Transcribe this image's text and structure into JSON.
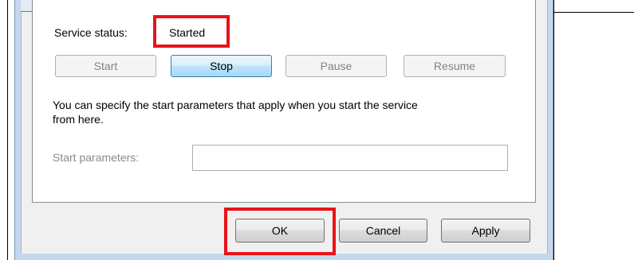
{
  "dialog": {
    "service_status_label": "Service status:",
    "service_status_value": "Started",
    "buttons": {
      "start": "Start",
      "stop": "Stop",
      "pause": "Pause",
      "resume": "Resume"
    },
    "description_line1": "You can specify the start parameters that apply when you start the service",
    "description_line2": "from here.",
    "start_parameters_label": "Start parameters:",
    "start_parameters_value": ""
  },
  "footer": {
    "ok": "OK",
    "cancel": "Cancel",
    "apply": "Apply"
  },
  "colors": {
    "highlight": "#e8131b",
    "frame": "#c4d7ee",
    "dialog_background": "#f0f0f0"
  }
}
